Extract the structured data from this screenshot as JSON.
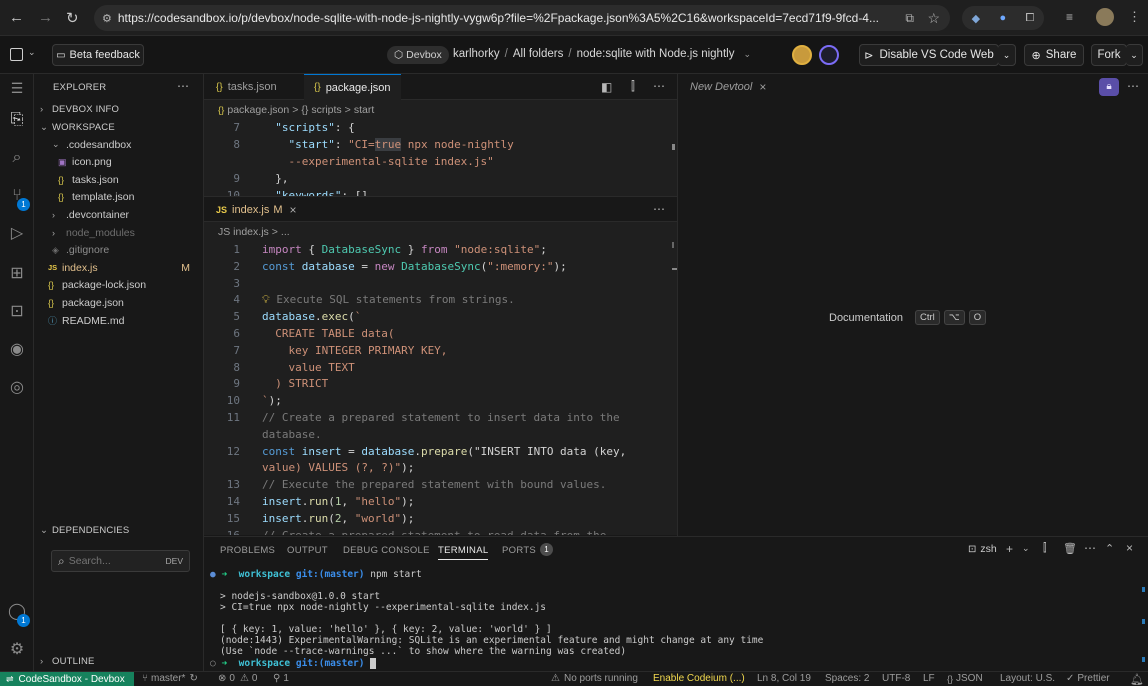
{
  "browser": {
    "url": "https://codesandbox.io/p/devbox/node-sqlite-with-node-js-nightly-vygw6p?file=%2Fpackage.json%3A5%2C16&workspaceId=7ecd71f9-9fcd-4..."
  },
  "header": {
    "beta_feedback": "Beta feedback",
    "devbox_badge": "Devbox",
    "breadcrumb_user": "karlhorky",
    "breadcrumb_sep1": "/",
    "breadcrumb_folders": "All folders",
    "breadcrumb_sep2": "/",
    "breadcrumb_project": "node:sqlite with Node.js nightly",
    "disable_vscode": "Disable VS Code Web",
    "share": "Share",
    "fork": "Fork"
  },
  "sidebar": {
    "explorer_title": "EXPLORER",
    "devbox_info": "DEVBOX INFO",
    "workspace": "WORKSPACE",
    "files": [
      {
        "name": ".codesandbox",
        "kind": "folder-open",
        "badge": ""
      },
      {
        "name": "icon.png",
        "kind": "image",
        "badge": ""
      },
      {
        "name": "tasks.json",
        "kind": "json",
        "badge": ""
      },
      {
        "name": "template.json",
        "kind": "json",
        "badge": ""
      },
      {
        "name": ".devcontainer",
        "kind": "folder",
        "badge": ""
      },
      {
        "name": "node_modules",
        "kind": "folder",
        "badge": ""
      },
      {
        "name": ".gitignore",
        "kind": "git",
        "badge": ""
      },
      {
        "name": "index.js",
        "kind": "js",
        "badge": "M"
      },
      {
        "name": "package-lock.json",
        "kind": "json",
        "badge": ""
      },
      {
        "name": "package.json",
        "kind": "json",
        "badge": ""
      },
      {
        "name": "README.md",
        "kind": "info",
        "badge": ""
      }
    ],
    "dependencies": "DEPENDENCIES",
    "search_placeholder": "Search...",
    "dev_label": "DEV",
    "outline": "OUTLINE"
  },
  "editor_top": {
    "tabs": [
      {
        "icon": "{}",
        "label": "tasks.json"
      },
      {
        "icon": "{}",
        "label": "package.json"
      }
    ],
    "breadcrumb": [
      "package.json",
      ">",
      "{} scripts",
      ">",
      "start"
    ],
    "lines": [
      {
        "n": "7",
        "text": "  \"scripts\": {"
      },
      {
        "n": "8",
        "text": "    \"start\": \"CI=true npx node-nightly"
      },
      {
        "n": "",
        "text": "    --experimental-sqlite index.js\""
      },
      {
        "n": "9",
        "text": "  },"
      },
      {
        "n": "10",
        "text": "  \"keywords\": []"
      }
    ]
  },
  "editor_bottom": {
    "tab_icon": "JS",
    "tab_label": "index.js",
    "tab_badge": "M",
    "breadcrumb": [
      "JS index.js",
      ">",
      "..."
    ],
    "lines": [
      {
        "n": "1",
        "text": "import { DatabaseSync } from \"node:sqlite\";"
      },
      {
        "n": "2",
        "text": "const database = new DatabaseSync(\":memory:\");"
      },
      {
        "n": "3",
        "text": ""
      },
      {
        "n": "4",
        "text": "// Execute SQL statements from strings."
      },
      {
        "n": "5",
        "text": "database.exec(`"
      },
      {
        "n": "6",
        "text": "  CREATE TABLE data("
      },
      {
        "n": "7",
        "text": "    key INTEGER PRIMARY KEY,"
      },
      {
        "n": "8",
        "text": "    value TEXT"
      },
      {
        "n": "9",
        "text": "  ) STRICT"
      },
      {
        "n": "10",
        "text": "`);"
      },
      {
        "n": "11",
        "text": "// Create a prepared statement to insert data into the"
      },
      {
        "n": "",
        "text": "database."
      },
      {
        "n": "12",
        "text": "const insert = database.prepare(\"INSERT INTO data (key,"
      },
      {
        "n": "",
        "text": "value) VALUES (?, ?)\");"
      },
      {
        "n": "13",
        "text": "// Execute the prepared statement with bound values."
      },
      {
        "n": "14",
        "text": "insert.run(1, \"hello\");"
      },
      {
        "n": "15",
        "text": "insert.run(2, \"world\");"
      },
      {
        "n": "16",
        "text": "// Create a prepared statement to read data from the"
      }
    ]
  },
  "devtool": {
    "tab_label": "New Devtool",
    "doc_label": "Documentation",
    "keys": [
      "Ctrl",
      "⌥",
      "O"
    ]
  },
  "panel": {
    "tabs": [
      "PROBLEMS",
      "OUTPUT",
      "DEBUG CONSOLE",
      "TERMINAL",
      "PORTS"
    ],
    "ports_count": "1",
    "shell": "zsh",
    "terminal": {
      "prompt_dir": "workspace",
      "prompt_git": "git:(master)",
      "command": "npm start",
      "out1": "> nodejs-sandbox@1.0.0 start",
      "out2": "> CI=true npx node-nightly --experimental-sqlite index.js",
      "out3": "[ { key: 1, value: 'hello' }, { key: 2, value: 'world' } ]",
      "out4": "(node:1443) ExperimentalWarning: SQLite is an experimental feature and might change at any time",
      "out5": "(Use `node --trace-warnings ...` to show where the warning was created)"
    }
  },
  "status": {
    "remote": "CodeSandbox - Devbox",
    "branch": "master*",
    "errors": "0",
    "warnings": "0",
    "ports": "1",
    "no_ports": "No ports running",
    "codeium": "Enable Codeium (...)",
    "position": "Ln 8, Col 19",
    "spaces": "Spaces: 2",
    "encoding": "UTF-8",
    "eol": "LF",
    "language": "JSON",
    "layout": "Layout: U.S.",
    "prettier": "Prettier"
  },
  "activity_badges": {
    "source_control": "1",
    "accounts": "1"
  },
  "colors": {
    "accent": "#0078d4",
    "remote_bg": "#16825d",
    "modified": "#e2c08d",
    "codeium": "#f2d94e"
  }
}
